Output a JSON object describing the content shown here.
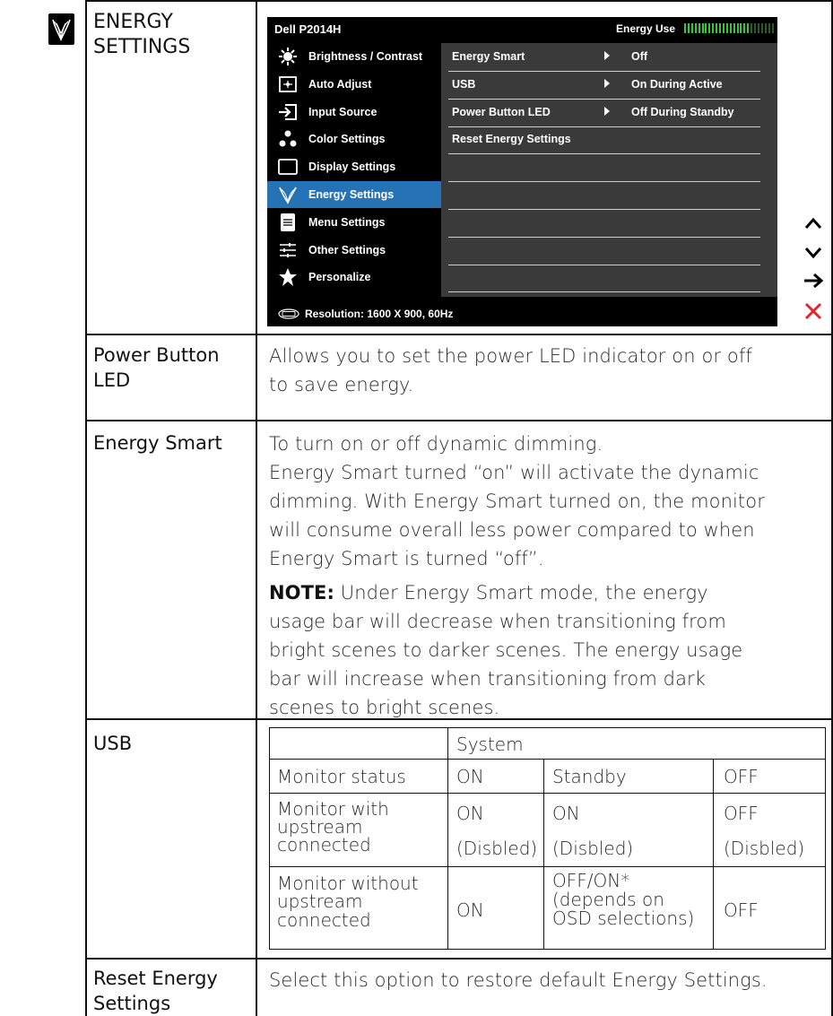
{
  "header": {
    "section_title_line1": "ENERGY",
    "section_title_line2": "SETTINGS"
  },
  "osd": {
    "model": "Dell P2014H",
    "energy_use_label": "Energy Use",
    "energy_use_level": 0.72,
    "menu": [
      {
        "label": "Brightness / Contrast",
        "icon": "brightness-icon",
        "selected": false
      },
      {
        "label": "Auto Adjust",
        "icon": "auto-adjust-icon",
        "selected": false
      },
      {
        "label": "Input Source",
        "icon": "input-source-icon",
        "selected": false
      },
      {
        "label": "Color Settings",
        "icon": "color-settings-icon",
        "selected": false
      },
      {
        "label": "Display Settings",
        "icon": "display-settings-icon",
        "selected": false
      },
      {
        "label": "Energy Settings",
        "icon": "energy-leaf-icon",
        "selected": true
      },
      {
        "label": "Menu Settings",
        "icon": "menu-settings-icon",
        "selected": false
      },
      {
        "label": "Other Settings",
        "icon": "other-settings-icon",
        "selected": false
      },
      {
        "label": "Personalize",
        "icon": "star-icon",
        "selected": false
      }
    ],
    "settings": [
      {
        "label": "Energy Smart",
        "value": "Off"
      },
      {
        "label": "USB",
        "value": "On During Active"
      },
      {
        "label": "Power Button LED",
        "value": "Off During Standby"
      },
      {
        "label": "Reset Energy Settings",
        "value": ""
      }
    ],
    "resolution_prefix": "Resolution:",
    "resolution_value": "1600 X 900, 60Hz",
    "colors": {
      "background": "#000000",
      "panel": "#3a3a3a",
      "selected": "#2573b5",
      "close": "#e3262c"
    }
  },
  "nav_buttons": [
    "up-arrow-icon",
    "down-arrow-icon",
    "enter-arrow-icon",
    "close-x-icon"
  ],
  "rows": {
    "power_led": {
      "label_line1": "Power Button",
      "label_line2": "LED",
      "desc_line1": "Allows you to set the power LED indicator on or off",
      "desc_line2": "to save energy."
    },
    "energy_smart": {
      "label": "Energy Smart",
      "desc_lines": [
        "To turn on or off dynamic dimming.",
        "Energy Smart turned  “on” will activate the dynamic",
        "dimming. With Energy Smart turned on, the monitor",
        "will consume overall less power compared to when",
        "Energy Smart is turned “off”."
      ],
      "note_label": "NOTE:",
      "note_first": " Under Energy Smart mode, the energy",
      "note_lines": [
        "usage bar will decrease when transitioning from",
        "bright scenes to darker scenes. The energy usage",
        "bar will increase when transitioning from dark",
        "scenes to bright scenes."
      ]
    },
    "usb": {
      "label": "USB",
      "table": {
        "system_header": "System",
        "r1": {
          "label": "Monitor status",
          "c1": "ON",
          "c2": "Standby",
          "c3": "OFF"
        },
        "r2": {
          "label_lines": [
            "Monitor with",
            "upstream",
            "connected"
          ],
          "c1a": "ON",
          "c1b": "(Disbled)",
          "c2a": "ON",
          "c2b": "(Disbled)",
          "c3a": "OFF",
          "c3b": "(Disbled)"
        },
        "r3": {
          "label_lines": [
            "Monitor without",
            "upstream",
            "connected"
          ],
          "c1": "ON",
          "c2_lines": [
            "OFF/ON*",
            "(depends on",
            "OSD selections)"
          ],
          "c3": "OFF"
        }
      }
    },
    "reset": {
      "label_line1": "Reset Energy",
      "label_line2": "Settings",
      "desc": "Select this option to restore default Energy Settings."
    }
  }
}
